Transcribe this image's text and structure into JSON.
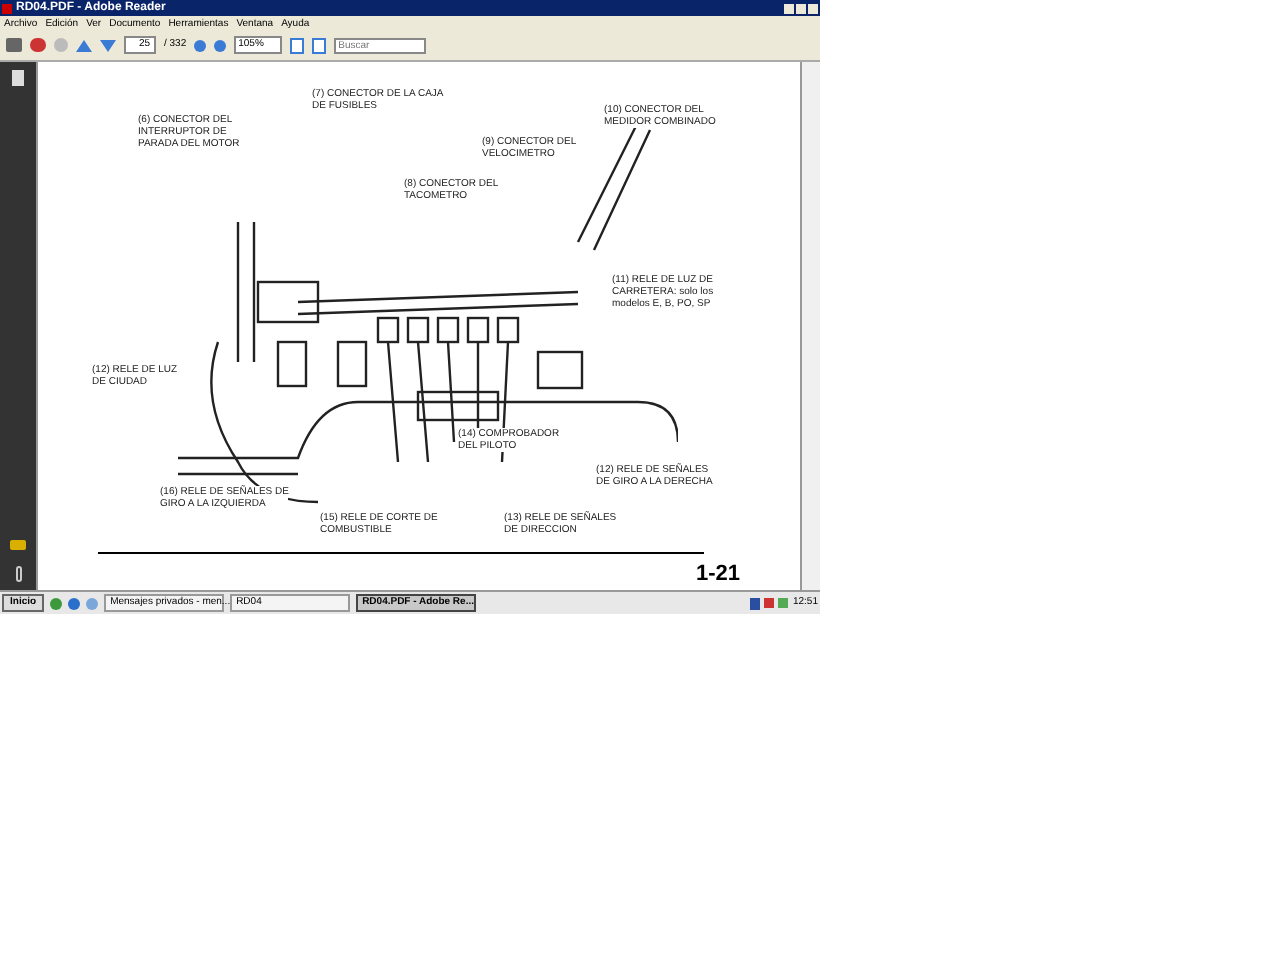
{
  "window": {
    "title": "RD04.PDF - Adobe Reader"
  },
  "menu": [
    "Archivo",
    "Edición",
    "Ver",
    "Documento",
    "Herramientas",
    "Ventana",
    "Ayuda"
  ],
  "toolbar": {
    "page": "25",
    "page_total": "/ 332",
    "zoom": "105%",
    "search": {
      "placeholder": "Buscar"
    }
  },
  "document": {
    "labels": [
      "(7) CONECTOR DE LA CAJA\nDE FUSIBLES",
      "(6) CONECTOR DEL\nINTERRUPTOR DE\nPARADA DEL MOTOR",
      "(10) CONECTOR DEL\nMEDIDOR COMBINADO",
      "(9) CONECTOR DEL\nVELOCIMETRO",
      "(8) CONECTOR DEL\nTACOMETRO",
      "(11) RELE DE LUZ DE\nCARRETERA: solo los\nmodelos E, B, PO, SP",
      "(12) RELE DE LUZ\nDE CIUDAD",
      "(14) COMPROBADOR\nDEL PILOTO",
      "(16) RELE DE SEÑALES DE\nGIRO A LA IZQUIERDA",
      "(15) RELE DE CORTE DE\nCOMBUSTIBLE",
      "(12) RELE DE SEÑALES\nDE GIRO A LA DERECHA",
      "(13) RELE DE SEÑALES\nDE DIRECCION"
    ],
    "page_number": "1-21"
  },
  "taskbar": {
    "start": "Inicio",
    "tasks": [
      {
        "label": "Mensajes privados - men...",
        "selected": false
      },
      {
        "label": "RD04",
        "selected": false
      },
      {
        "label": "RD04.PDF - Adobe Re...",
        "selected": true
      }
    ],
    "clock": "12:51"
  }
}
